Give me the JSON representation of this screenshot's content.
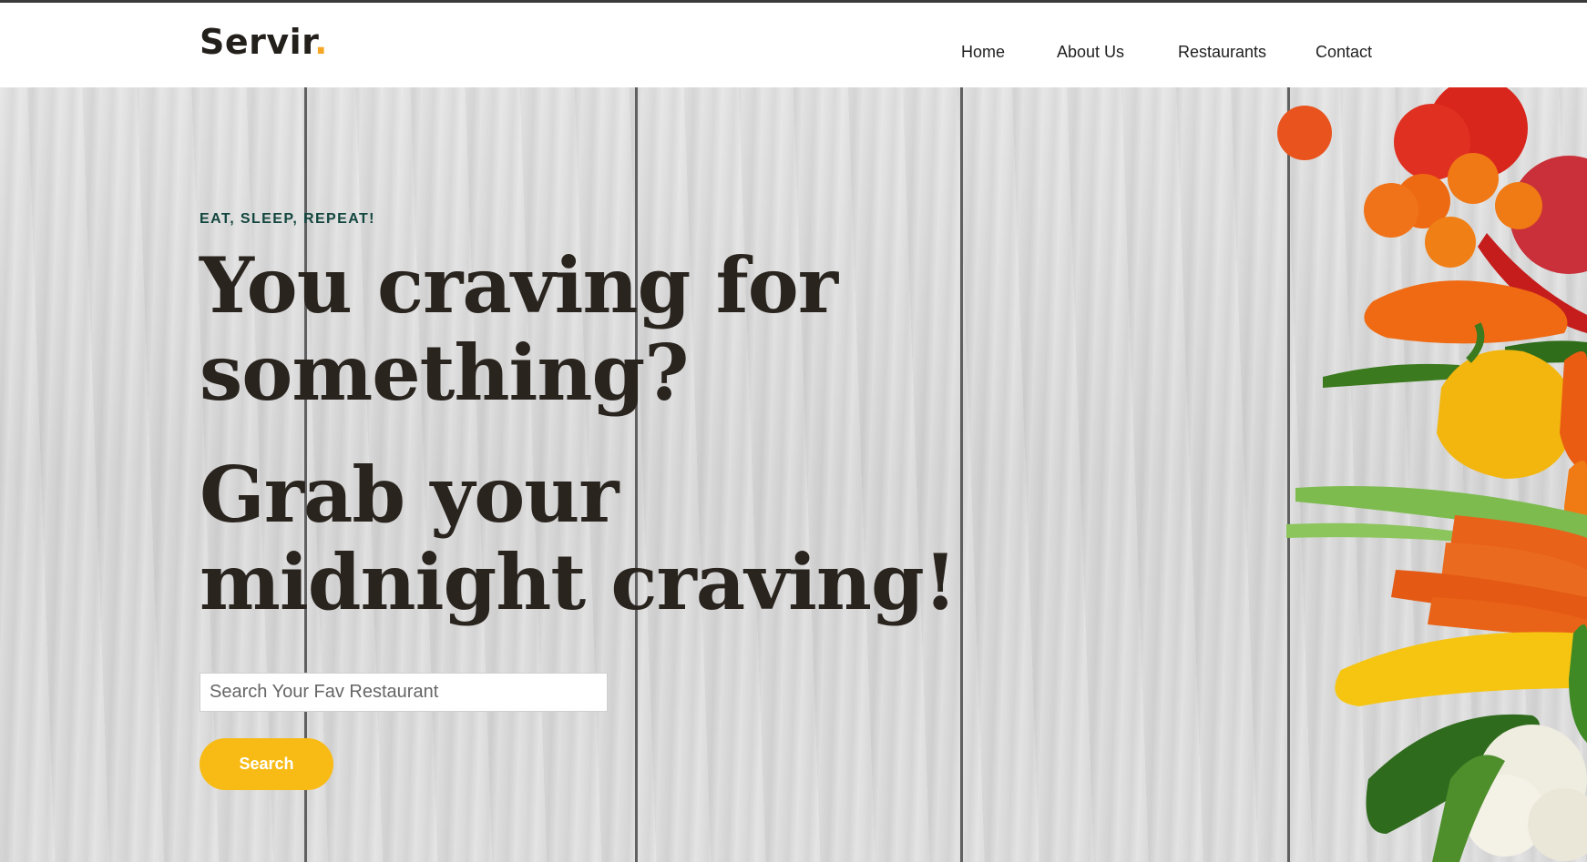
{
  "brand": {
    "name": "Servir",
    "dot": ".",
    "accent_color": "#f5a623"
  },
  "nav": {
    "items": [
      {
        "label": "Home"
      },
      {
        "label": "About Us"
      },
      {
        "label": "Restaurants"
      },
      {
        "label": "Contact"
      }
    ]
  },
  "hero": {
    "tagline": "EAT, SLEEP, REPEAT!",
    "headline_1": "You craving for something?",
    "headline_2": "Grab your midnight craving!",
    "search": {
      "placeholder": "Search Your Fav Restaurant",
      "value": ""
    },
    "search_button_label": "Search",
    "button_color": "#f8bb15",
    "tagline_color": "#13463f"
  }
}
